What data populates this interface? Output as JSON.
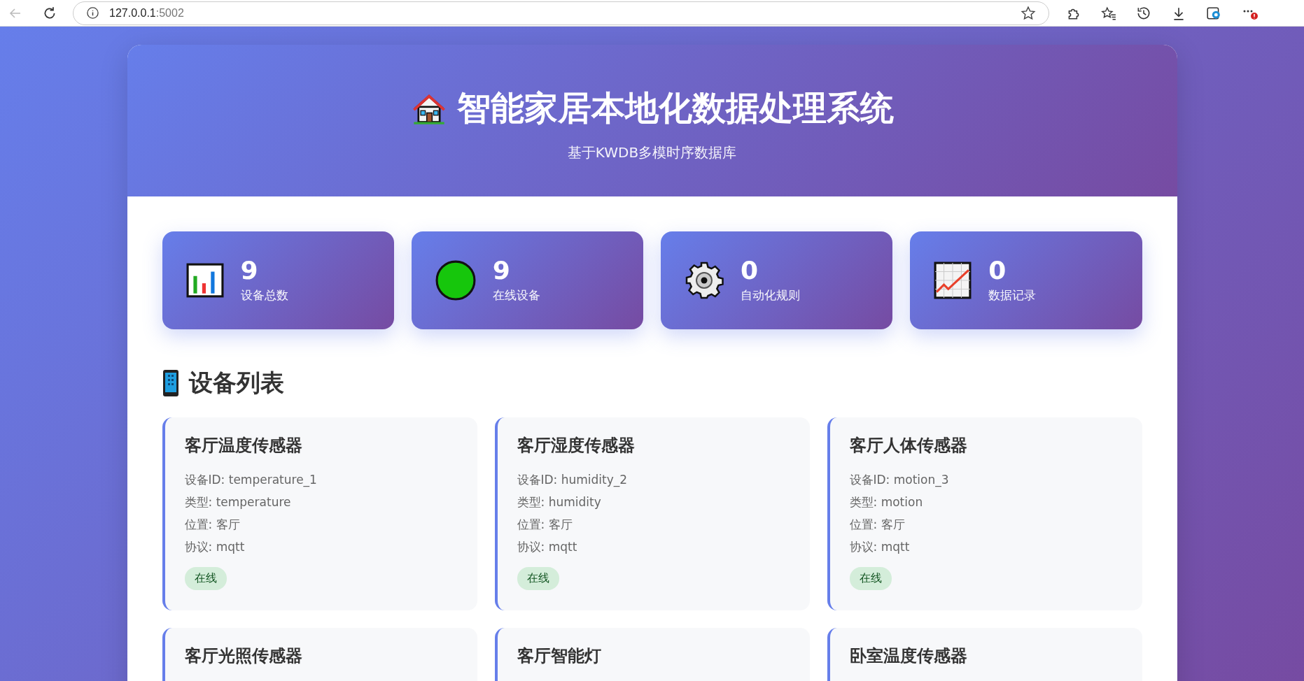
{
  "browser": {
    "address_host": "127.0.0.1",
    "address_port": ":5002"
  },
  "header": {
    "title": "智能家居本地化数据处理系统",
    "subtitle": "基于KWDB多模时序数据库"
  },
  "stats": [
    {
      "kind": "chart",
      "value": "9",
      "label": "设备总数"
    },
    {
      "kind": "circle",
      "value": "9",
      "label": "在线设备"
    },
    {
      "kind": "gear",
      "value": "0",
      "label": "自动化规则"
    },
    {
      "kind": "trend",
      "value": "0",
      "label": "数据记录"
    }
  ],
  "device_section": {
    "title": "设备列表"
  },
  "devices": [
    {
      "name": "客厅温度传感器",
      "details": [
        "设备ID: temperature_1",
        "类型: temperature",
        "位置: 客厅",
        "协议: mqtt"
      ],
      "status": {
        "label": "在线",
        "online": true
      }
    },
    {
      "name": "客厅湿度传感器",
      "details": [
        "设备ID: humidity_2",
        "类型: humidity",
        "位置: 客厅",
        "协议: mqtt"
      ],
      "status": {
        "label": "在线",
        "online": true
      }
    },
    {
      "name": "客厅人体传感器",
      "details": [
        "设备ID: motion_3",
        "类型: motion",
        "位置: 客厅",
        "协议: mqtt"
      ],
      "status": {
        "label": "在线",
        "online": true
      }
    },
    {
      "name": "客厅光照传感器"
    },
    {
      "name": "客厅智能灯"
    },
    {
      "name": "卧室温度传感器"
    }
  ]
}
